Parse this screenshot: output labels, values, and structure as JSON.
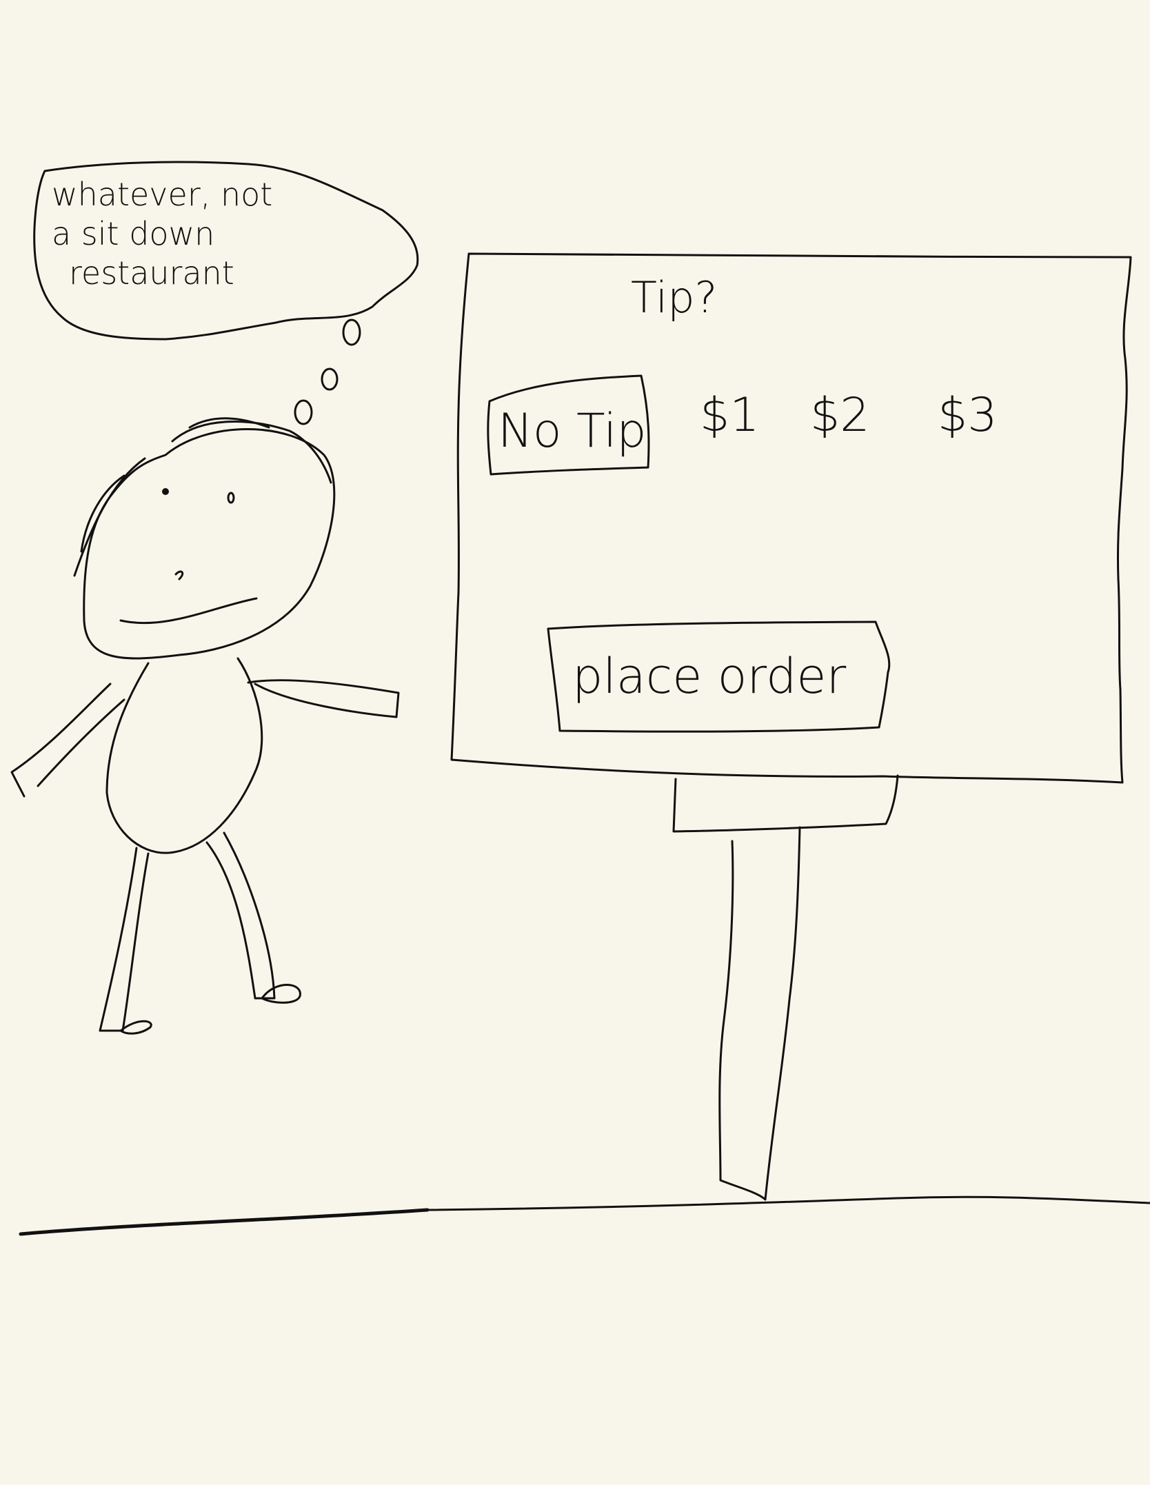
{
  "thought_bubble": {
    "lines": [
      "whatever, not",
      "a sit down",
      "restaurant"
    ]
  },
  "kiosk": {
    "title": "Tip?",
    "tip_options": [
      {
        "label": "No Tip",
        "selected": true
      },
      {
        "label": "$1",
        "selected": false
      },
      {
        "label": "$2",
        "selected": false
      },
      {
        "label": "$3",
        "selected": false
      }
    ],
    "place_order_label": "place order"
  },
  "colors": {
    "background": "#f8f6ea",
    "ink": "#111111"
  }
}
